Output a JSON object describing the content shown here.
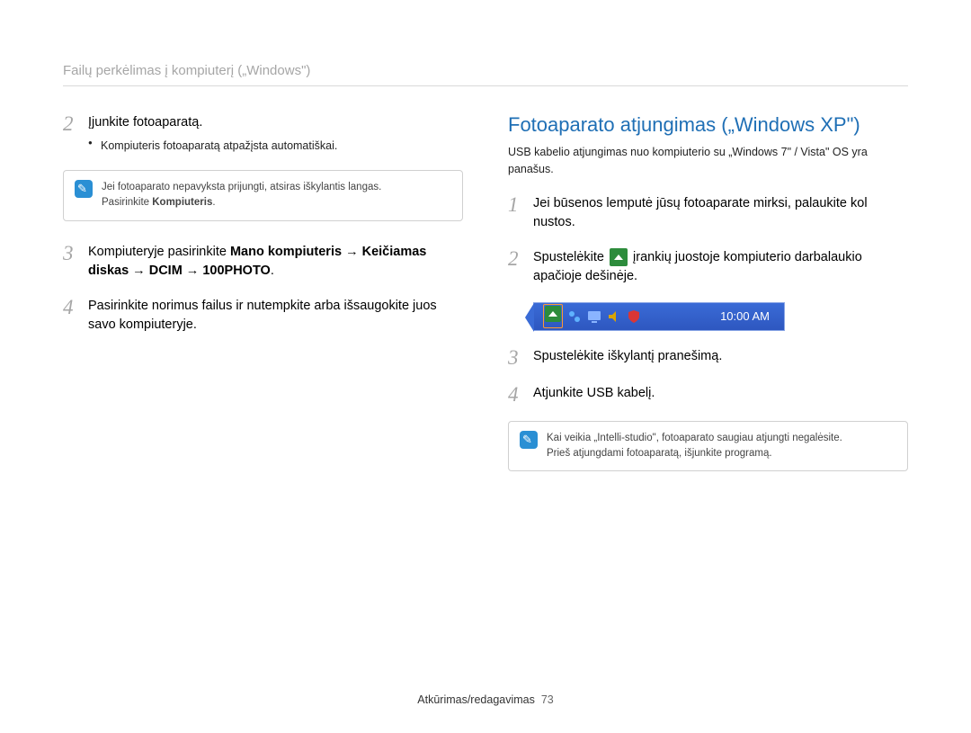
{
  "breadcrumb": "Failų perkėlimas į kompiuterį („Windows\")",
  "left": {
    "step2": {
      "num": "2",
      "text": "Įjunkite fotoaparatą.",
      "bullet": "Kompiuteris fotoaparatą atpažįsta automatiškai."
    },
    "note1_line1": "Jei fotoaparato nepavyksta prijungti, atsiras iškylantis langas.",
    "note1_line2_a": "Pasirinkite ",
    "note1_line2_b": "Kompiuteris",
    "note1_line2_c": ".",
    "step3": {
      "num": "3",
      "pre": "Kompiuteryje pasirinkite ",
      "b1": "Mano kompiuteris",
      "arr1": " → ",
      "b2": "Keičiamas diskas",
      "arr2": " → ",
      "b3": "DCIM",
      "arr3": " → ",
      "b4": "100PHOTO",
      "post": "."
    },
    "step4": {
      "num": "4",
      "text": "Pasirinkite norimus failus ir nutempkite arba išsaugokite juos savo kompiuteryje."
    }
  },
  "right": {
    "title": "Fotoaparato atjungimas („Windows XP\")",
    "intro": "USB kabelio atjungimas nuo kompiuterio su „Windows 7\" / Vista\" OS yra panašus.",
    "step1": {
      "num": "1",
      "text": "Jei būsenos lemputė jūsų fotoaparate mirksi, palaukite kol nustos."
    },
    "step2": {
      "num": "2",
      "pre": "Spustelėkite ",
      "post": " įrankių juostoje kompiuterio darbalaukio apačioje dešinėje."
    },
    "tray_time": "10:00 AM",
    "step3": {
      "num": "3",
      "text": "Spustelėkite iškylantį pranešimą."
    },
    "step4": {
      "num": "4",
      "text": "Atjunkite USB kabelį."
    },
    "note2_line1": "Kai veikia „Intelli-studio\", fotoaparato saugiau atjungti negalėsite.",
    "note2_line2": "Prieš atjungdami fotoaparatą, išjunkite programą."
  },
  "footer": {
    "label": "Atkūrimas/redagavimas",
    "page": "73"
  }
}
